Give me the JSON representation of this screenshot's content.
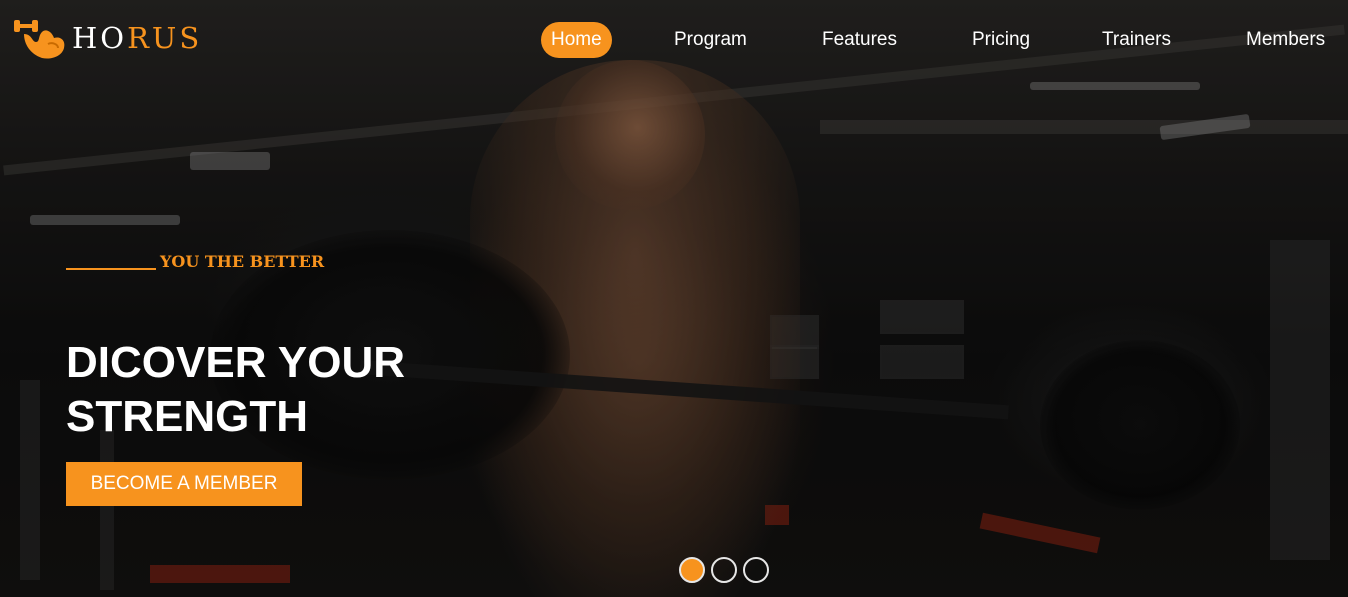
{
  "brand": {
    "name_part1": "HO",
    "name_part2": "RUS",
    "logo_icon": "flexing-arm-icon",
    "accent_color": "#f7931e"
  },
  "nav": {
    "items": [
      {
        "label": "Home",
        "active": true
      },
      {
        "label": "Program",
        "active": false
      },
      {
        "label": "Features",
        "active": false
      },
      {
        "label": "Pricing",
        "active": false
      },
      {
        "label": "Trainers",
        "active": false
      },
      {
        "label": "Members",
        "active": false
      }
    ]
  },
  "hero": {
    "tagline": "YOU THE BETTER",
    "headline_line1": "DICOVER YOUR",
    "headline_line2": "STRENGTH",
    "cta_label": "BECOME A MEMBER"
  },
  "slider": {
    "count": 3,
    "active_index": 0
  }
}
